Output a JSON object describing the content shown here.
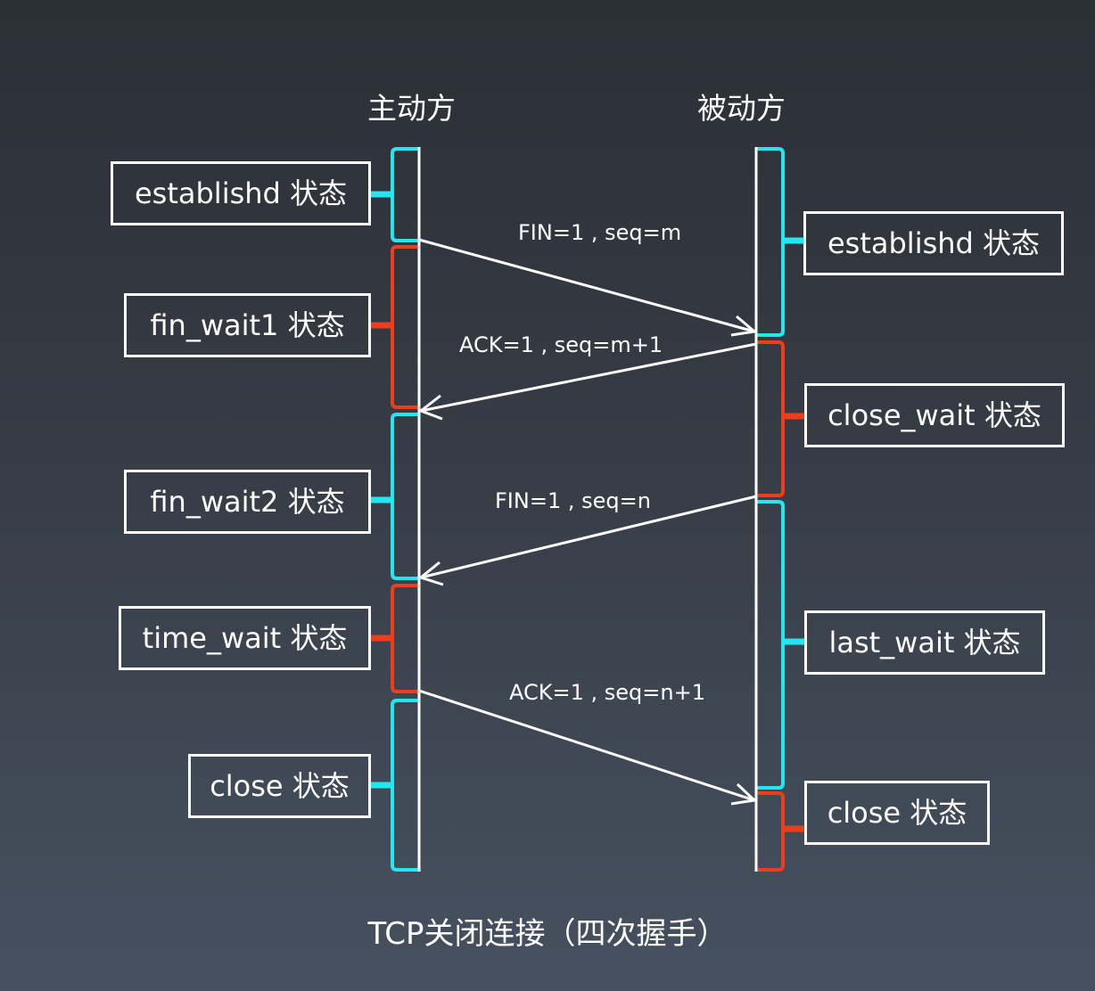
{
  "roles": {
    "active": "主动方",
    "passive": "被动方"
  },
  "active_states": [
    {
      "label": "establishd 状态",
      "phase": "cyan"
    },
    {
      "label": "fin_wait1 状态",
      "phase": "red"
    },
    {
      "label": "fin_wait2 状态",
      "phase": "cyan"
    },
    {
      "label": "time_wait 状态",
      "phase": "red"
    },
    {
      "label": "close 状态",
      "phase": "cyan"
    }
  ],
  "passive_states": [
    {
      "label": "establishd 状态",
      "phase": "cyan"
    },
    {
      "label": "close_wait 状态",
      "phase": "red"
    },
    {
      "label": "last_wait 状态",
      "phase": "cyan"
    },
    {
      "label": "close 状态",
      "phase": "red"
    }
  ],
  "messages": [
    {
      "label": "FIN=1 , seq=m",
      "direction": "active-to-passive"
    },
    {
      "label": "ACK=1 , seq=m+1",
      "direction": "passive-to-active"
    },
    {
      "label": "FIN=1 , seq=n",
      "direction": "passive-to-active"
    },
    {
      "label": "ACK=1 , seq=n+1",
      "direction": "active-to-passive"
    }
  ],
  "caption": "TCP关闭连接（四次握手）",
  "colors": {
    "cyan": "#22e6f0",
    "red": "#ee3d1c",
    "line": "#ffffff"
  }
}
